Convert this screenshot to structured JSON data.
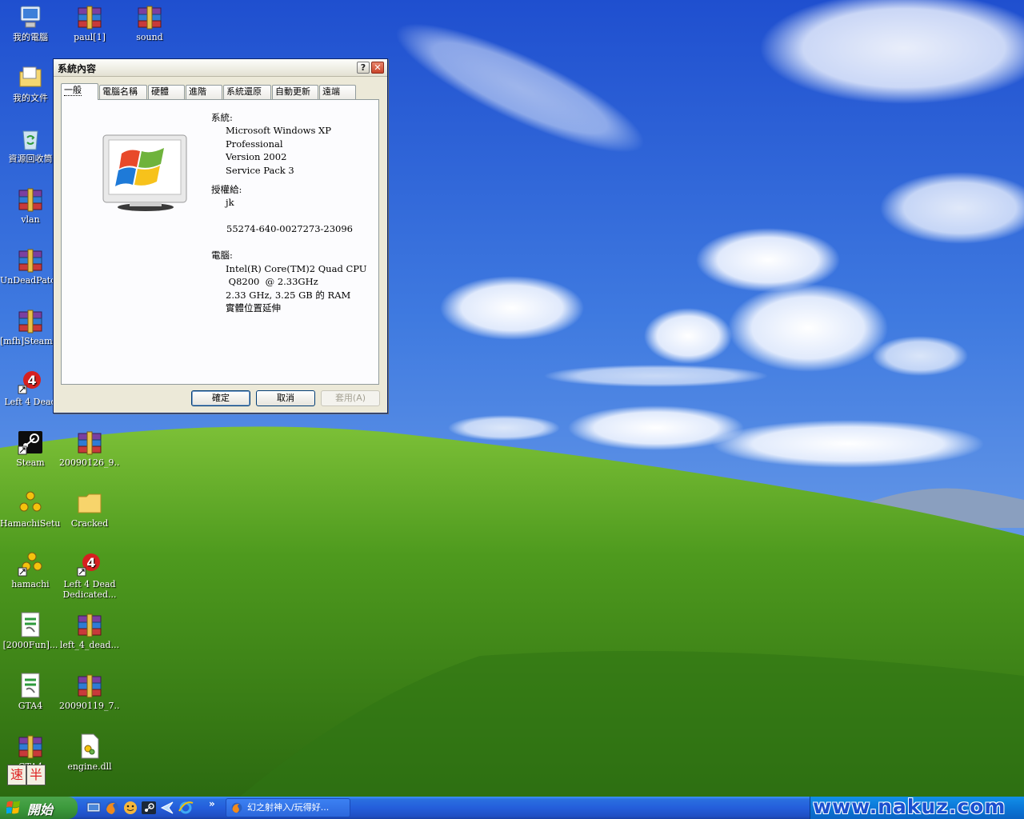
{
  "desktop": {
    "icons": [
      {
        "label": "我的電腦",
        "icon": "my-computer-icon"
      },
      {
        "label": "paul[1]",
        "icon": "winrar-archive-icon"
      },
      {
        "label": "sound",
        "icon": "winrar-archive-icon"
      },
      {
        "label": "我的文件",
        "icon": "my-documents-icon"
      },
      {
        "label": "資源回收筒",
        "icon": "recycle-bin-icon"
      },
      {
        "label": "vlan",
        "icon": "winrar-archive-icon"
      },
      {
        "label": "UnDeadPatc...",
        "icon": "winrar-archive-icon"
      },
      {
        "label": "[mfh]Steam_...",
        "icon": "winrar-archive-icon"
      },
      {
        "label": "Left 4 Dead",
        "icon": "left4dead-shortcut-icon"
      },
      {
        "label": "Steam",
        "icon": "steam-shortcut-icon"
      },
      {
        "label": "20090126_9...",
        "icon": "winrar-archive-icon"
      },
      {
        "label": "HamachiSetu...",
        "icon": "hamachi-setup-icon"
      },
      {
        "label": "Cracked",
        "icon": "folder-icon"
      },
      {
        "label": "hamachi",
        "icon": "hamachi-shortcut-icon"
      },
      {
        "label": "Left 4 Dead Dedicated...",
        "icon": "left4dead-shortcut-icon"
      },
      {
        "label": "[2000Fun]...",
        "icon": "gta-icon"
      },
      {
        "label": "left_4_dead...",
        "icon": "winrar-archive-icon"
      },
      {
        "label": "GTA4",
        "icon": "gta-icon"
      },
      {
        "label": "20090119_7...",
        "icon": "winrar-archive-icon"
      },
      {
        "label": "GTA4",
        "icon": "winrar-archive-icon"
      },
      {
        "label": "engine.dll",
        "icon": "dll-file-icon"
      }
    ]
  },
  "dialog": {
    "title": "系統內容",
    "help": "?",
    "close": "✕",
    "tabs": [
      "一般",
      "電腦名稱",
      "硬體",
      "進階",
      "系統還原",
      "自動更新",
      "遠端"
    ],
    "active_tab": "一般",
    "system_heading": "系統:",
    "system_lines": [
      "Microsoft Windows XP",
      "Professional",
      "Version 2002",
      "Service Pack 3"
    ],
    "registered_heading": "授權給:",
    "registered_user": "jk",
    "product_id": "55274-640-0027273-23096",
    "computer_heading": "電腦:",
    "computer_lines": [
      "Intel(R) Core(TM)2 Quad  CPU",
      " Q8200  @ 2.33GHz",
      "2.33 GHz, 3.25 GB 的 RAM",
      "實體位置延伸"
    ],
    "buttons": {
      "ok": "確定",
      "cancel": "取消",
      "apply": "套用(A)"
    }
  },
  "taskbar": {
    "start_label": "開始",
    "quicklaunch": [
      "show-desktop-icon",
      "firefox-icon",
      "messenger-icon",
      "steam-icon",
      "arrow-icon",
      "internet-explorer-icon"
    ],
    "chevron": "»",
    "task_label": "幻之射神入/玩得好...",
    "ime": [
      "速",
      "半"
    ]
  },
  "watermark": "www.nakuz.com",
  "colors": {
    "title_active": "#0a246a",
    "taskbar_blue": "#245edb",
    "start_green": "#3c9a3c",
    "tray_blue": "#0b77d7"
  }
}
